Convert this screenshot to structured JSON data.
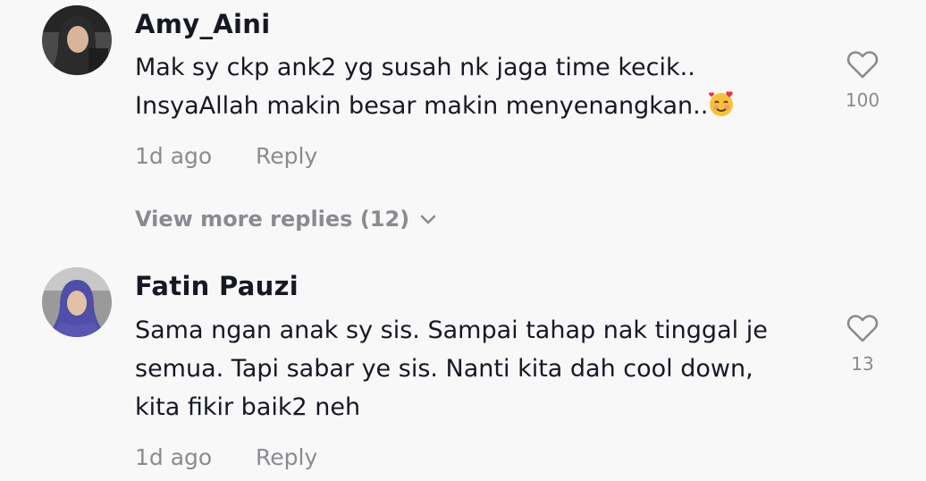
{
  "comments": [
    {
      "username": "Amy_Aini",
      "line1": "Mak sy ckp ank2 yg susah nk jaga time kecik..",
      "line2": "InsyaAllah makin besar makin menyenangkan..",
      "emoji": "smiling-face-with-hearts-emoji",
      "time": "1d ago",
      "reply_label": "Reply",
      "likes": "100",
      "avatar_icon": "user-avatar",
      "colors": {
        "avatar_bg": "#3a3a3a",
        "hijab": "#2b2b2b"
      }
    },
    {
      "username": "Fatin Pauzi",
      "line1": "Sama ngan anak sy sis. Sampai tahap nak tinggal je",
      "line2": "semua. Tapi sabar ye sis. Nanti kita dah cool down,",
      "line3": "kita fikir baik2 neh",
      "time": "1d ago",
      "reply_label": "Reply",
      "likes": "13",
      "avatar_icon": "user-avatar",
      "colors": {
        "avatar_bg": "#8a8a8a",
        "hijab": "#4a4aa0"
      }
    }
  ],
  "view_more": "View more replies (12)",
  "colors": {
    "background": "#f8f8f8",
    "text": "#161823",
    "muted": "#8a8b91"
  }
}
